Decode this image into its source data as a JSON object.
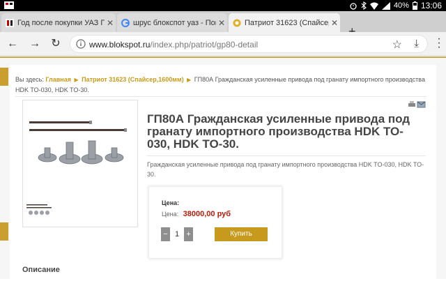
{
  "status_bar": {
    "battery": "40%",
    "time": "13:06"
  },
  "tabs": [
    {
      "label": "Год после покупки УАЗ Па"
    },
    {
      "label": "шрус блокспот уаз - Поиск"
    },
    {
      "label": "Патриот 31623 (Спайсер,1"
    }
  ],
  "address_bar": {
    "domain": "www.blokspot.ru",
    "path": "/index.php/patriot/gp80-detail"
  },
  "breadcrumb": {
    "prefix": "Вы здесь:",
    "items": [
      "Главная",
      "Патриот 31623 (Спайсер,1600мм)"
    ],
    "current": "ГП80А Гражданская усиленные привода под гранату импортного производства HDK TO-030, HDK TO-30."
  },
  "product": {
    "title": "ГП80А Гражданская усиленные привода под гранату импортного производства HDK TO-030, HDK TO-30.",
    "description": "Гражданская усиленные привода под гранату импортного производства HDK TO-030, HDK TO-30.",
    "price_label": "Цена:",
    "price_line_label": "Цена:",
    "price_value": "38000,00 руб",
    "quantity": "1",
    "minus": "−",
    "plus": "+",
    "buy_label": "Купить"
  },
  "section": {
    "description_heading": "Описание"
  },
  "colors": {
    "accent": "#c9a030",
    "price": "#b51c0c"
  }
}
